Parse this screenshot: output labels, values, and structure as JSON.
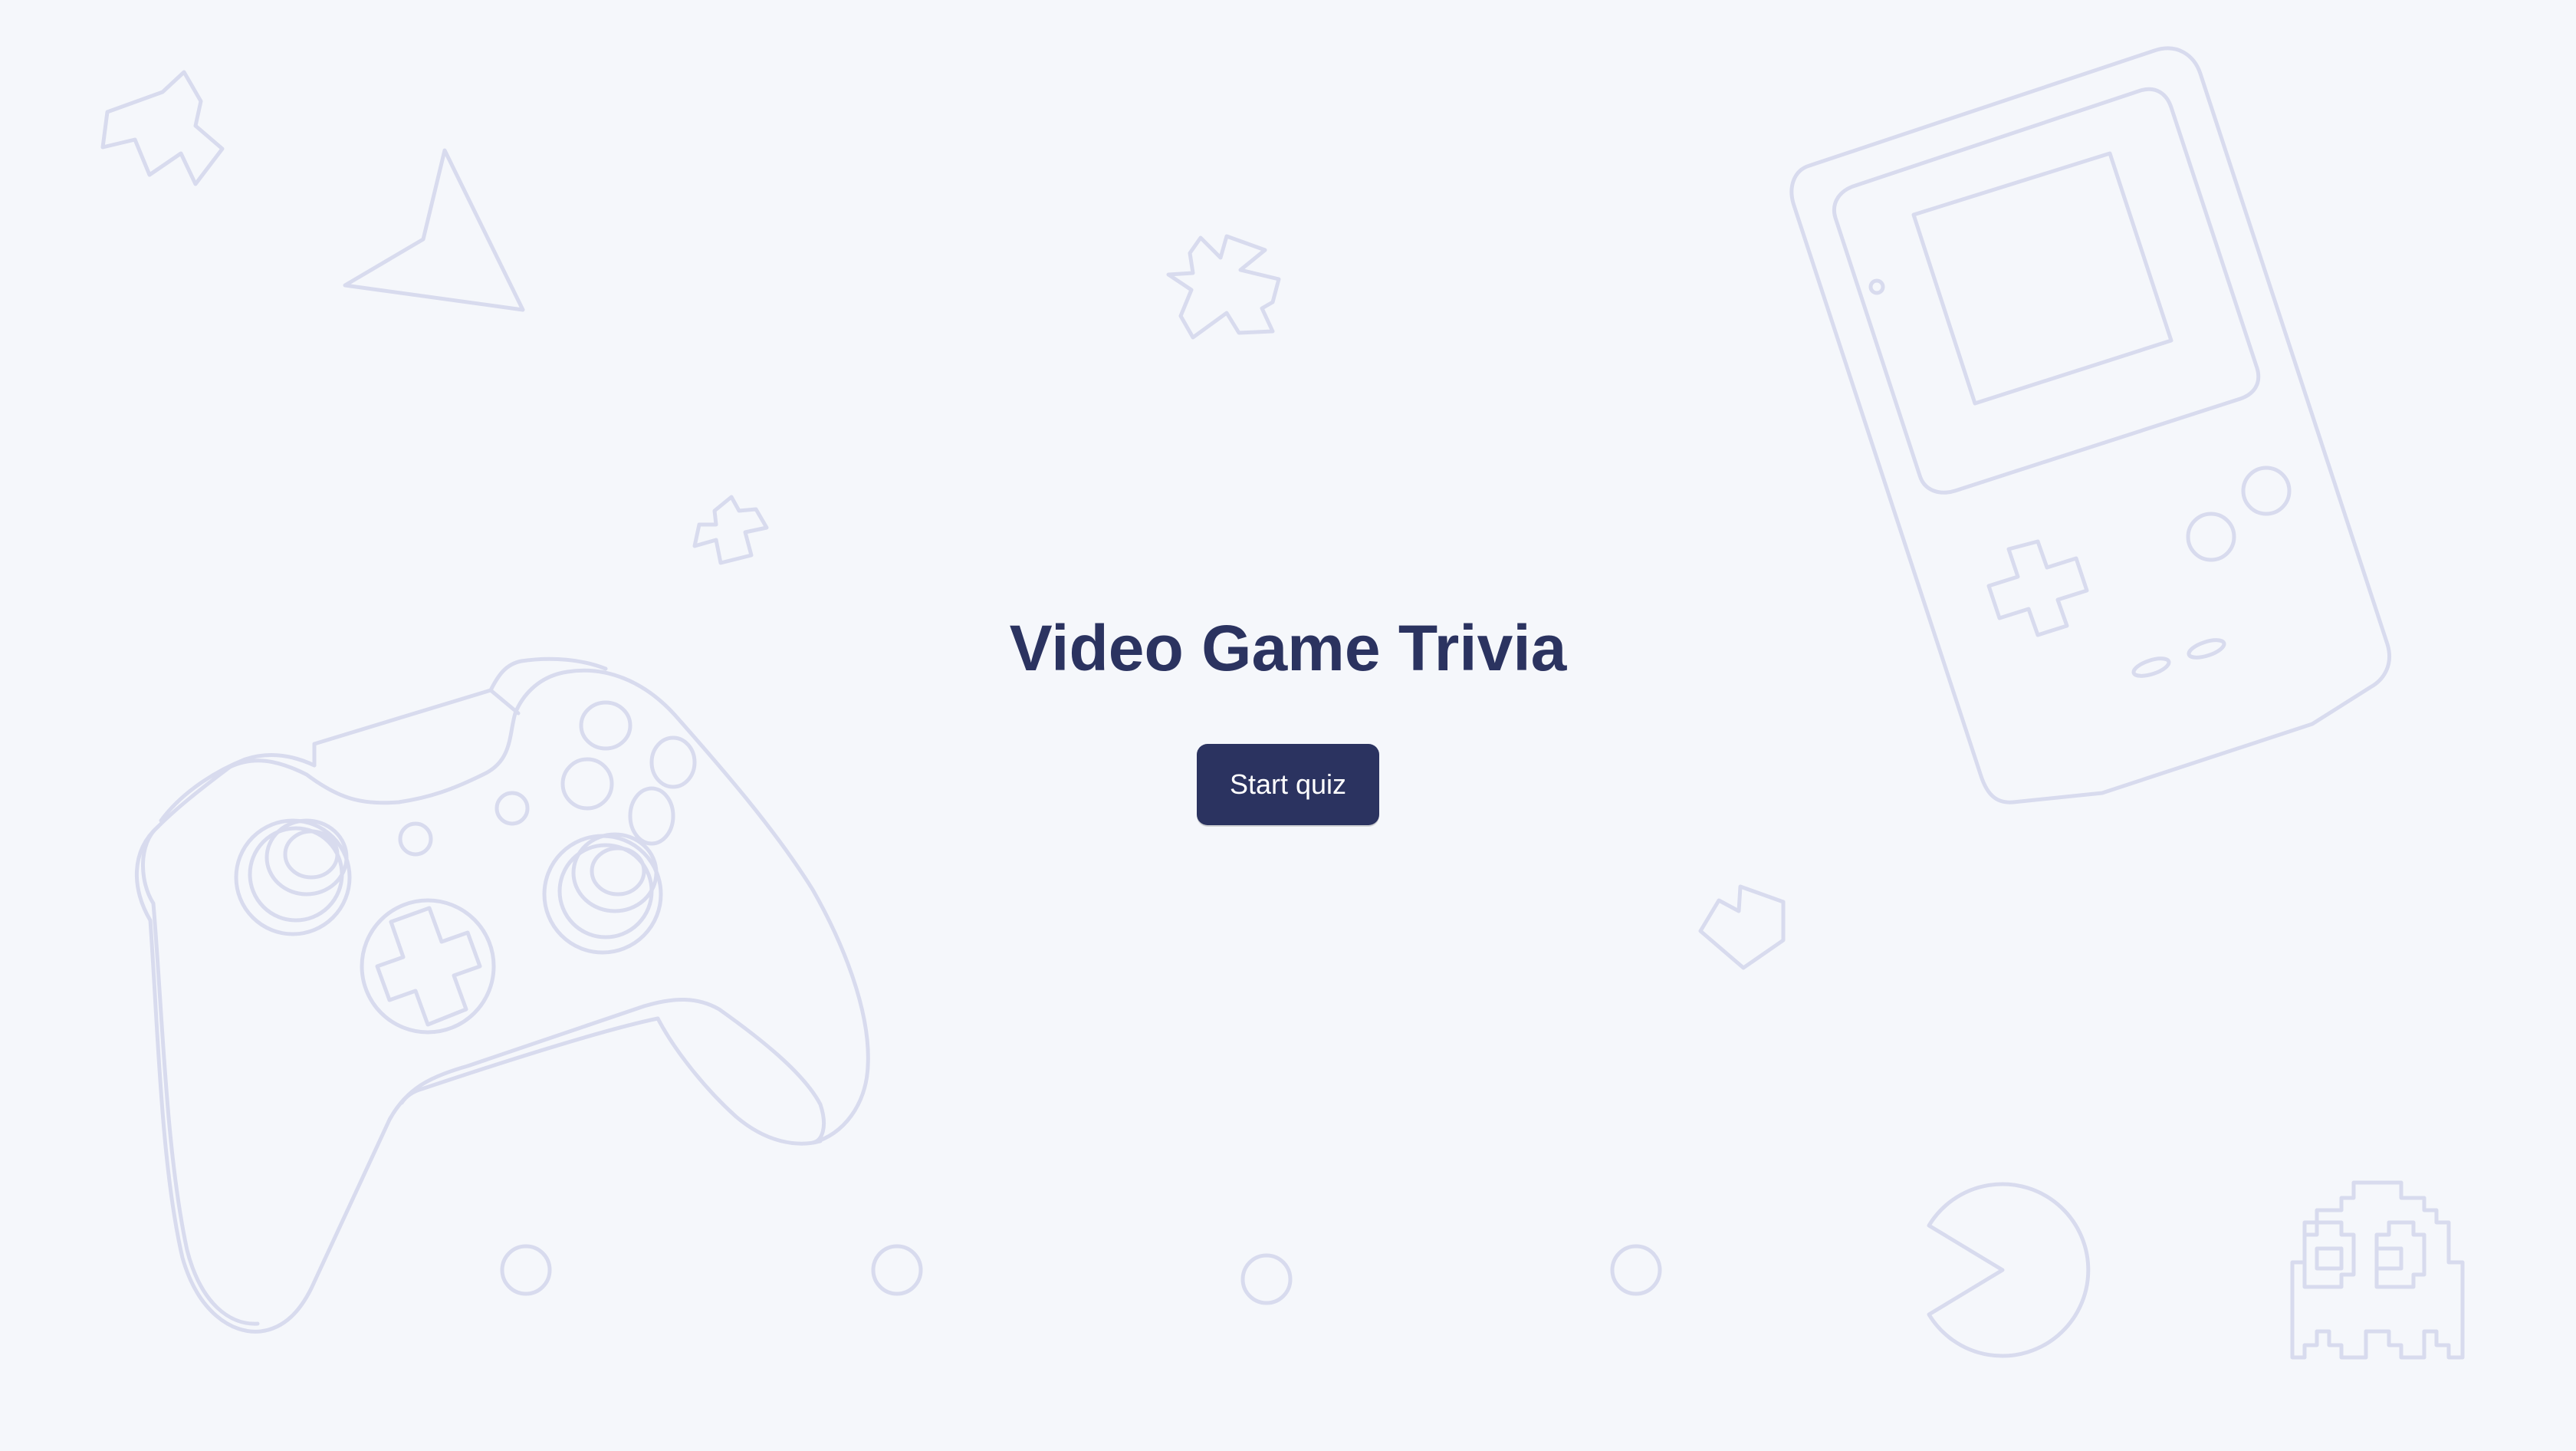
{
  "quiz": {
    "title": "Video Game Trivia",
    "start_label": "Start quiz"
  },
  "colors": {
    "background": "#f5f7fb",
    "primary": "#2b3360",
    "button_text": "#ffffff",
    "decoration_stroke": "#d8dbee"
  },
  "decorations": [
    "asteroid-icon",
    "arrow-ship-icon",
    "game-controller-icon",
    "handheld-console-icon",
    "pac-man-icon",
    "ghost-icon",
    "pellet-icon"
  ]
}
